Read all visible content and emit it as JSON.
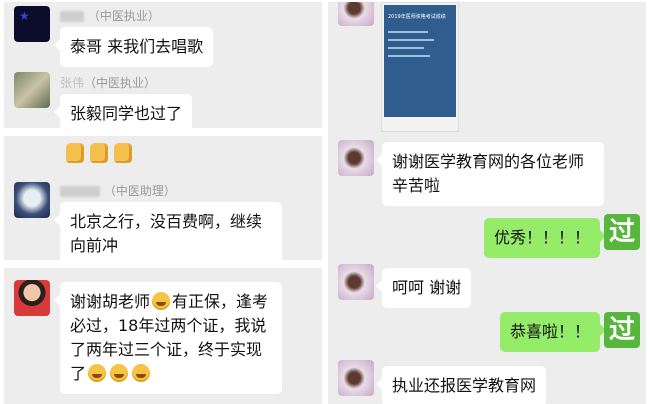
{
  "messages": {
    "m1": {
      "name": "（中医执业）",
      "text": "泰哥 来我们去唱歌"
    },
    "m2": {
      "name_prefix": "张伟",
      "name": "（中医执业）",
      "text": "张毅同学也过了"
    },
    "m3": {
      "name": "（中医助理）",
      "text": "北京之行，没百费啊，继续向前冲"
    },
    "m4": {
      "text_a": "谢谢胡老师",
      "text_b": "有正保，逢考必过，18年过两个证，我说了两年过三个证，终于实现了"
    },
    "r1": {
      "text": "谢谢医学教育网的各位老师辛苦啦"
    },
    "r2": {
      "text": "优秀！！！！"
    },
    "r3": {
      "text": "呵呵 谢谢"
    },
    "r4": {
      "text": "恭喜啦！！"
    },
    "r5": {
      "text": "执业还报医学教育网"
    }
  },
  "score_card": {
    "title": "2019年医师资格考试成绩"
  },
  "icons": {
    "guo": "过",
    "colors": {
      "wechat_green": "#95ec69",
      "sticker_green": "#57b63c",
      "chat_bg": "#ededed"
    }
  }
}
